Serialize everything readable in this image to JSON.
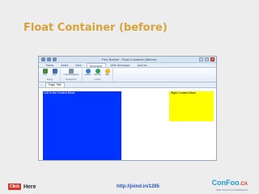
{
  "slide": {
    "title": "Float Container (before)",
    "footer_badge": "Click",
    "footer_text": "Here",
    "footer_link": "http://joind.in/1285",
    "logo_main": "ConFoo",
    "logo_suffix": ".CA",
    "logo_sub": "WEB TECHNO CONFERENCE"
  },
  "app": {
    "window_title": "Flex Builder - Float Container (Before)",
    "tabs": [
      "Home",
      "Insert",
      "View",
      "Developer",
      "Web Developer",
      "Add-ins"
    ],
    "active_tab": "Developer",
    "ribbon_groups": [
      {
        "label": "Debug",
        "buttons": [
          {
            "label": "Run",
            "icon": "run-icon"
          },
          {
            "label": "Stop",
            "icon": "stop-icon"
          }
        ]
      },
      {
        "label": "Breakpoints",
        "buttons": [
          {
            "label": "Insert Breakpoint",
            "icon": "breakpoint-icon"
          }
        ]
      },
      {
        "label": "Update",
        "buttons": [
          {
            "label": "Update",
            "icon": "update-icon"
          },
          {
            "label": "Refresh",
            "icon": "refresh-icon"
          },
          {
            "label": "Help",
            "icon": "help-icon"
          }
        ]
      }
    ],
    "document_tab": "Page Title",
    "regions": {
      "left_label": "Left to the Content Block",
      "right_label": "Right Content Block"
    },
    "colors": {
      "left_region": "#0033ff",
      "right_region": "#ffff00",
      "title": "#d8a33a"
    }
  }
}
